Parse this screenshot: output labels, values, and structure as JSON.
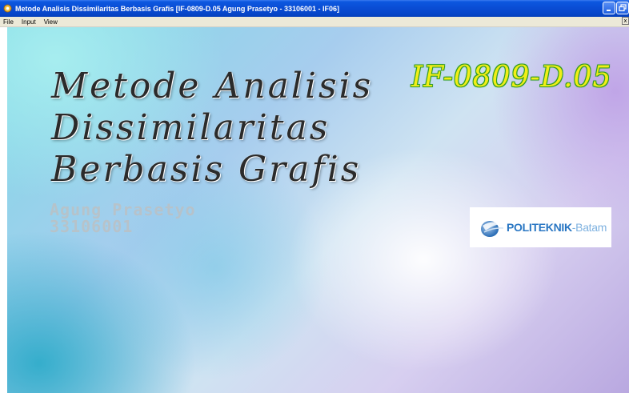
{
  "window": {
    "title": "Metode Analisis Dissimilaritas  Berbasis Grafis [IF-0809-D.05 Agung Prasetyo - 33106001 - IF06]",
    "icon": "app-icon",
    "controls": [
      "minimize-icon",
      "maximize-icon",
      "close-icon"
    ],
    "close_mini_glyph": "x"
  },
  "menu": {
    "items": [
      {
        "label": "File"
      },
      {
        "label": "Input"
      },
      {
        "label": "View"
      }
    ]
  },
  "splash": {
    "title_lines": [
      "Metode Analisis",
      "Dissimilaritas",
      "Berbasis Grafis"
    ],
    "code": "IF-0809-D.05",
    "author_name": "Agung Prasetyo",
    "author_id": "33106001",
    "logo": {
      "word1": "POLITEKNIK",
      "separator": "-",
      "word2": "Batam",
      "icon": "politeknik-logo-icon"
    }
  },
  "colors": {
    "titlebar": "#0a4cd3",
    "menubar": "#ece9d8",
    "title_text": "#2b2b2b",
    "code_fill": "#f2ee17",
    "code_outline": "#2f9a20",
    "author_text": "#bfbfbf",
    "logo_blue": "#2a77c3",
    "logo_light_blue": "#7fb2e0"
  }
}
